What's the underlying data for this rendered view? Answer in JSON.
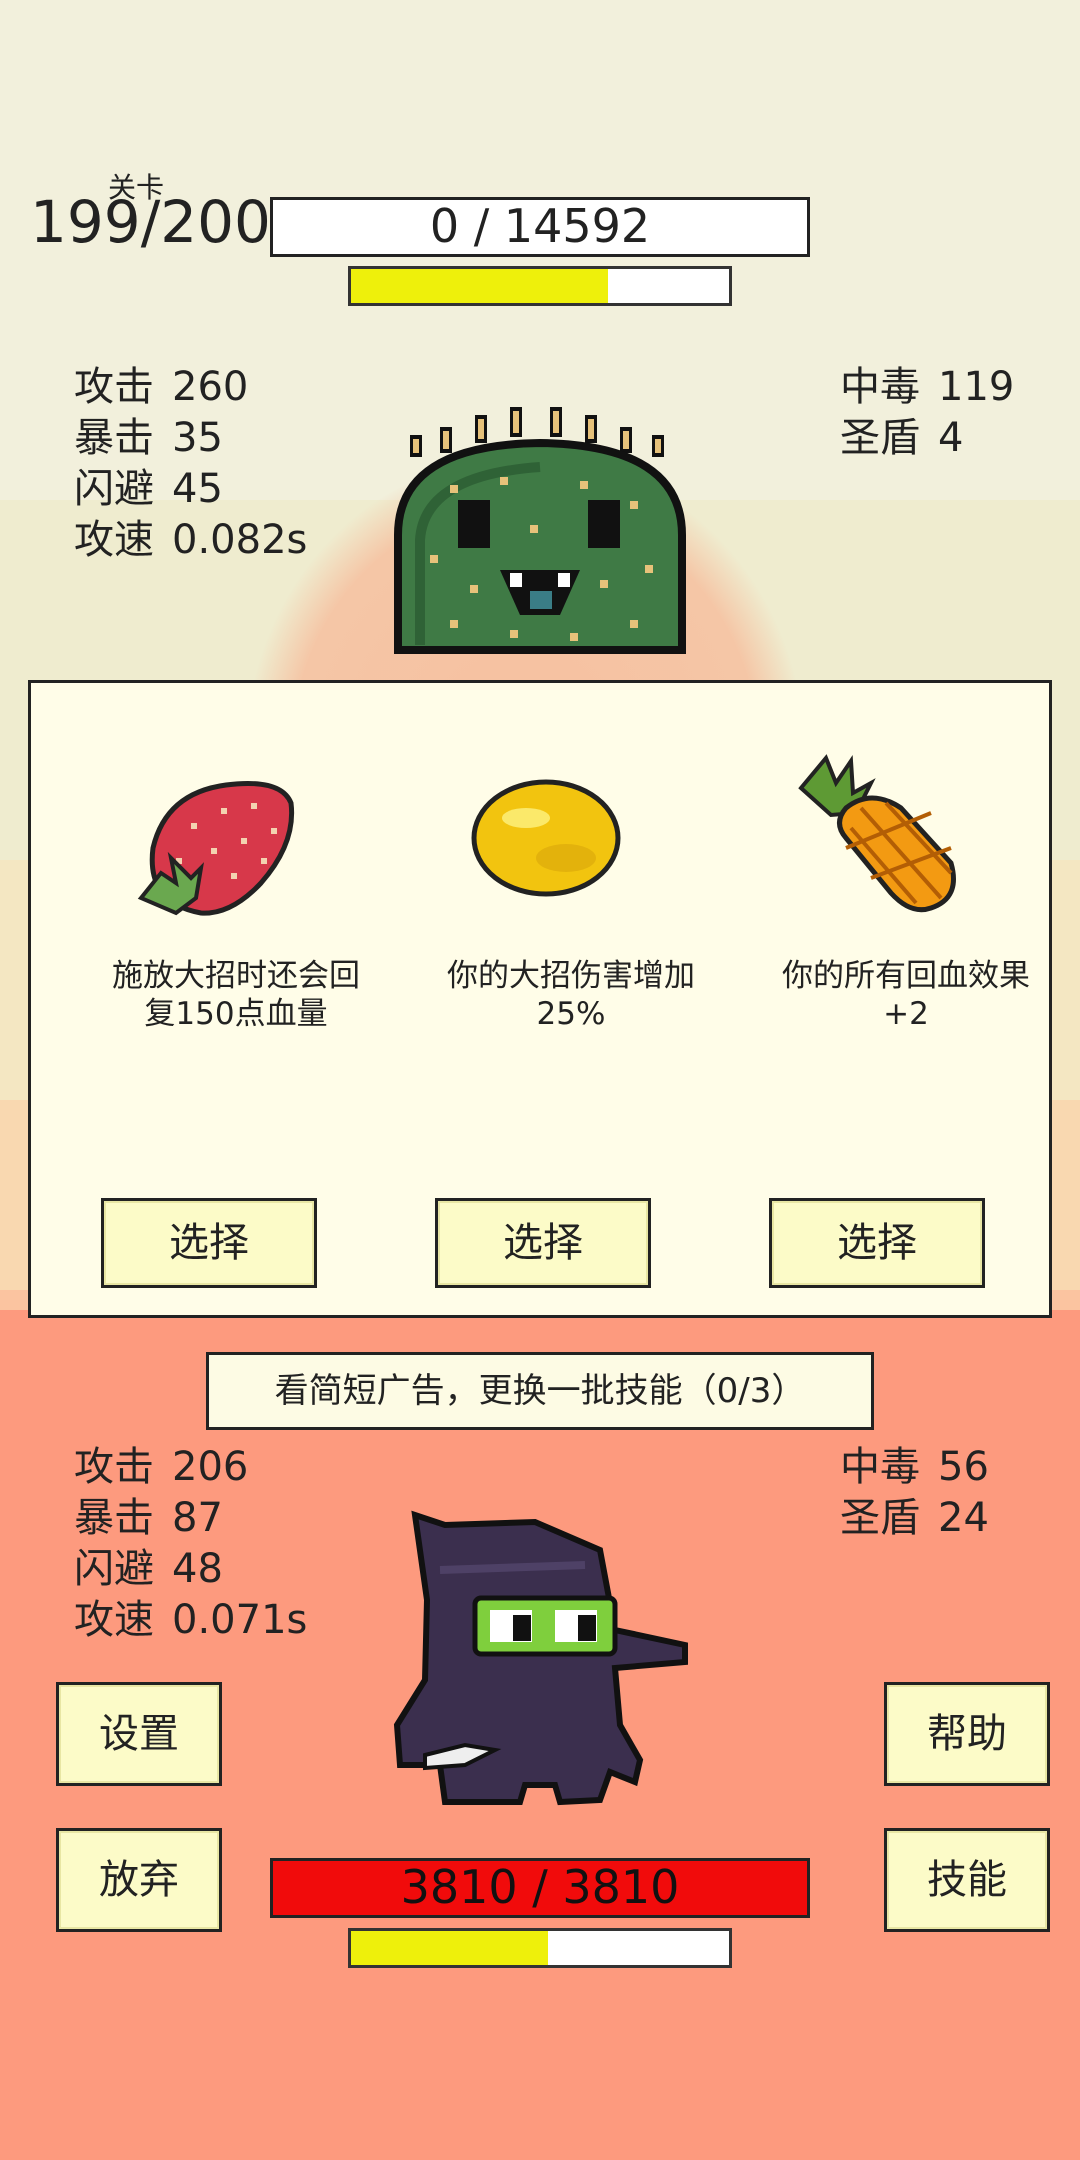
{
  "stage": {
    "label": "关卡",
    "value": "199/200"
  },
  "enemy": {
    "hp_text": "0 / 14592",
    "energy_fraction": 0.68,
    "stats_left": [
      {
        "label": "攻击",
        "value": "260"
      },
      {
        "label": "暴击",
        "value": "35"
      },
      {
        "label": "闪避",
        "value": "45"
      },
      {
        "label": "攻速",
        "value": "0.082s"
      }
    ],
    "stats_right": [
      {
        "label": "中毒",
        "value": "119"
      },
      {
        "label": "圣盾",
        "value": "4"
      }
    ],
    "sprite_icon": "cactus-monster-icon"
  },
  "choices": [
    {
      "icon": "strawberry-icon",
      "desc_line1": "施放大招时还会回",
      "desc_line2": "复150点血量",
      "button": "选择"
    },
    {
      "icon": "lemon-icon",
      "desc_line1": "你的大招伤害增加",
      "desc_line2": "25%",
      "button": "选择"
    },
    {
      "icon": "pineapple-icon",
      "desc_line1": "你的所有回血效果",
      "desc_line2": "+2",
      "button": "选择"
    }
  ],
  "ad_button": "看简短广告，更换一批技能（0/3）",
  "player": {
    "hp_text": "3810 / 3810",
    "energy_fraction": 0.52,
    "stats_left": [
      {
        "label": "攻击",
        "value": "206"
      },
      {
        "label": "暴击",
        "value": "87"
      },
      {
        "label": "闪避",
        "value": "48"
      },
      {
        "label": "攻速",
        "value": "0.071s"
      }
    ],
    "stats_right": [
      {
        "label": "中毒",
        "value": "56"
      },
      {
        "label": "圣盾",
        "value": "24"
      }
    ],
    "sprite_icon": "ninja-character-icon"
  },
  "buttons": {
    "settings": "设置",
    "help": "帮助",
    "give_up": "放弃",
    "skills": "技能"
  },
  "colors": {
    "hp_red": "#f10b0b",
    "energy_yellow": "#eef00b",
    "button_bg": "#fcfbc8",
    "player_bg": "#fd9a7e"
  }
}
